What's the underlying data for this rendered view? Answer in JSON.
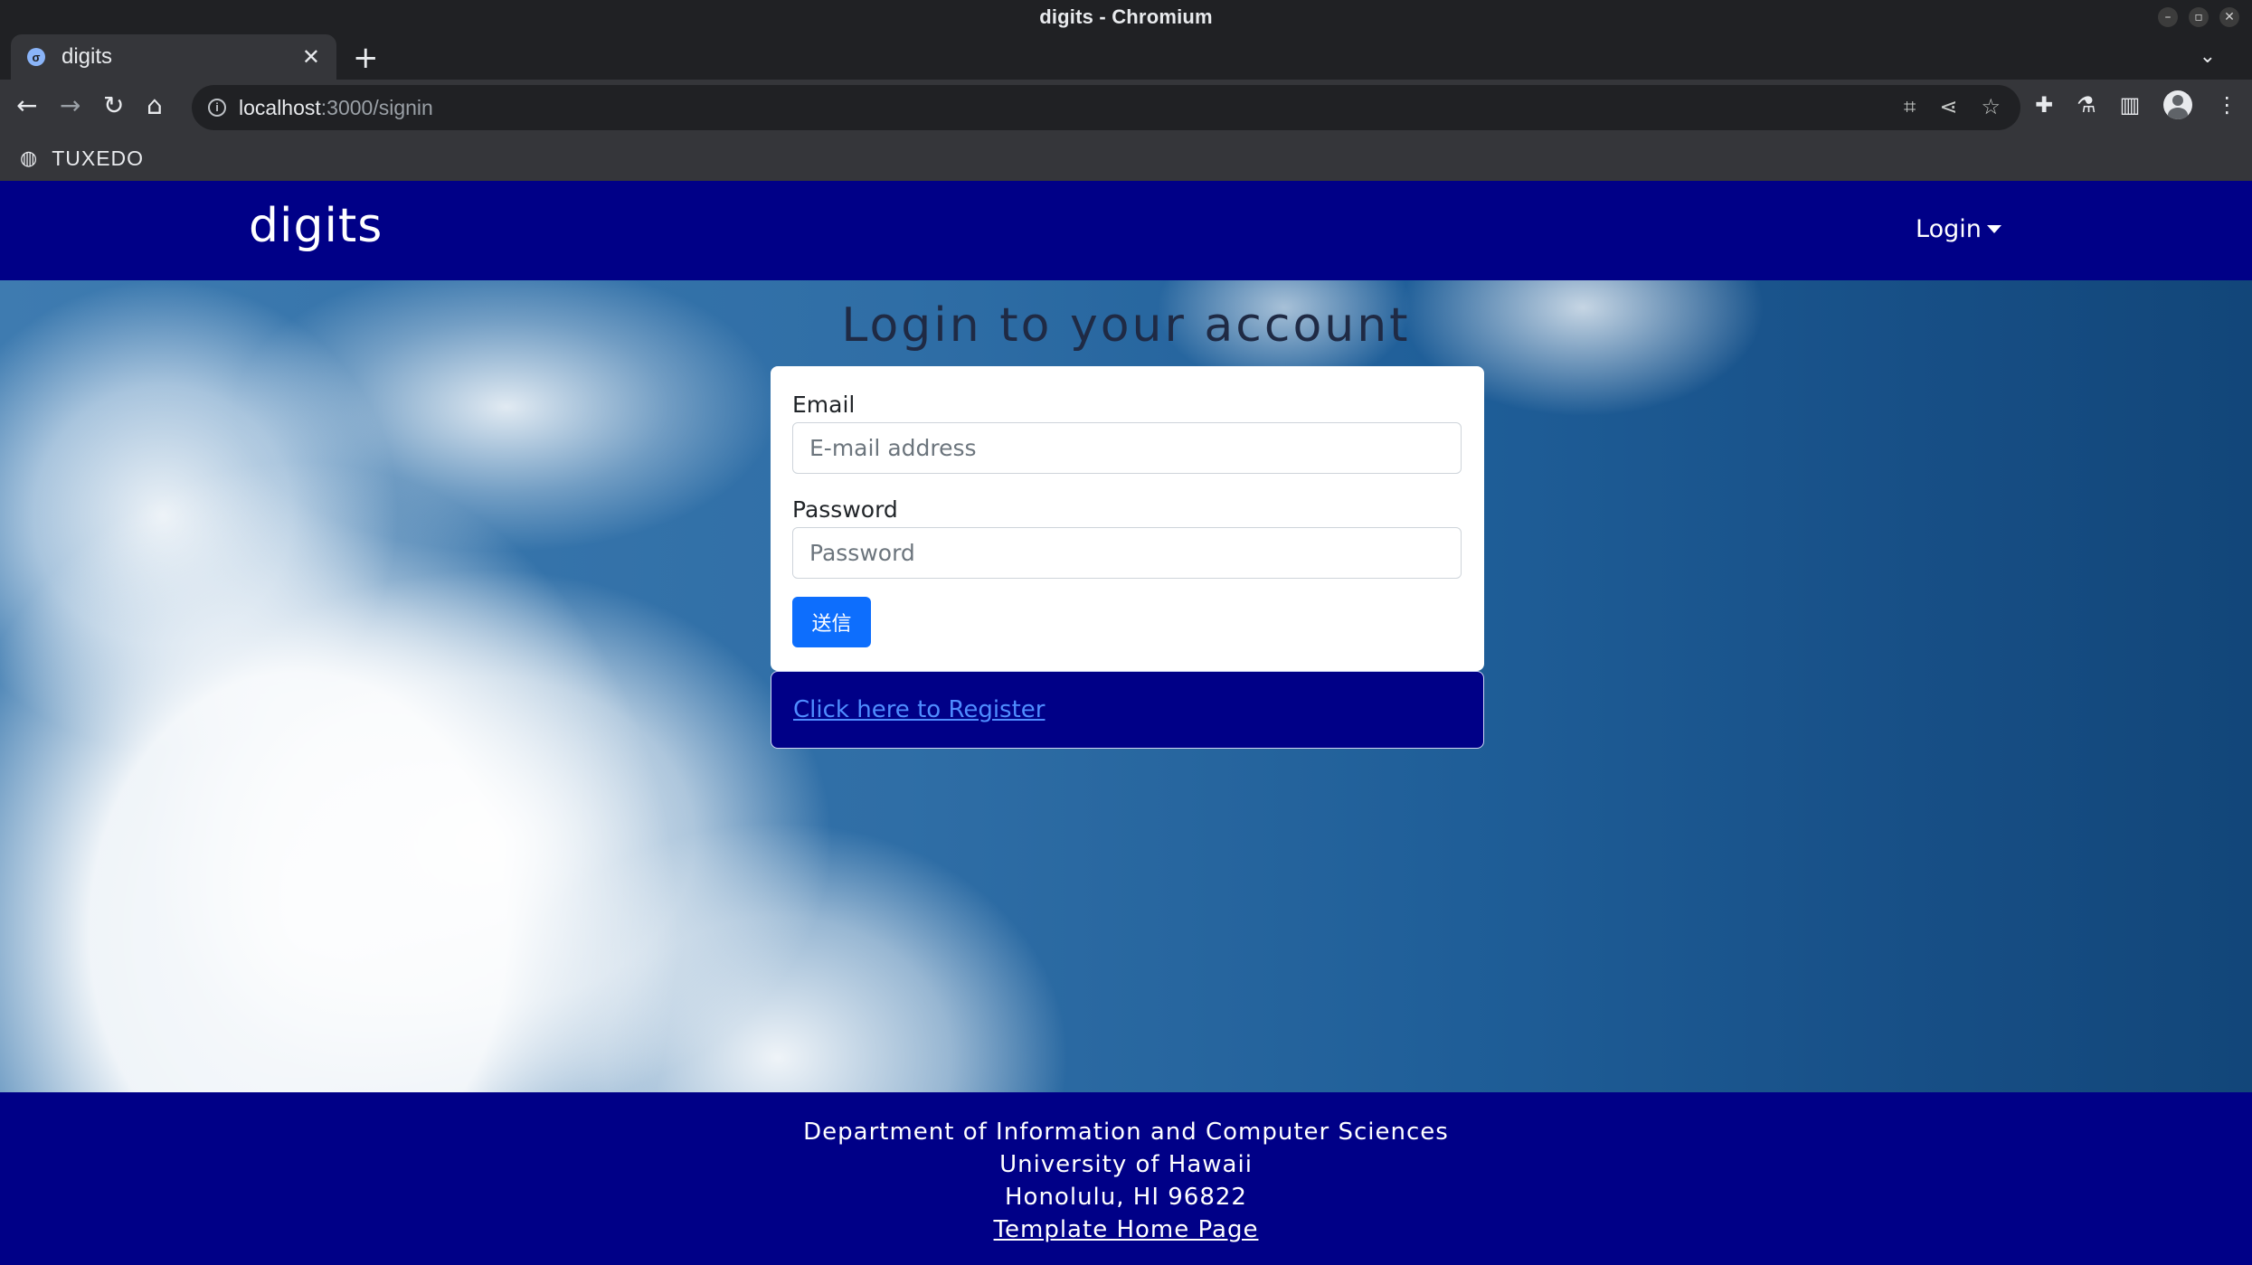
{
  "window": {
    "title": "digits - Chromium"
  },
  "tab": {
    "label": "digits"
  },
  "address_bar": {
    "host": "localhost",
    "path": ":3000/signin"
  },
  "bookmarks": {
    "item": "TUXEDO"
  },
  "navbar": {
    "brand": "digits",
    "login_menu": "Login"
  },
  "login": {
    "heading": "Login to your account",
    "email_label": "Email",
    "email_placeholder": "E-mail address",
    "password_label": "Password",
    "password_placeholder": "Password",
    "submit_label": "送信",
    "register_link": "Click here to Register"
  },
  "footer": {
    "line1": "Department of Information and Computer Sciences",
    "line2": "University of Hawaii",
    "line3": "Honolulu, HI 96822",
    "link": "Template Home Page"
  },
  "colors": {
    "brand": "#000087",
    "primary_button": "#0d6efd",
    "link": "#4f8dff"
  }
}
